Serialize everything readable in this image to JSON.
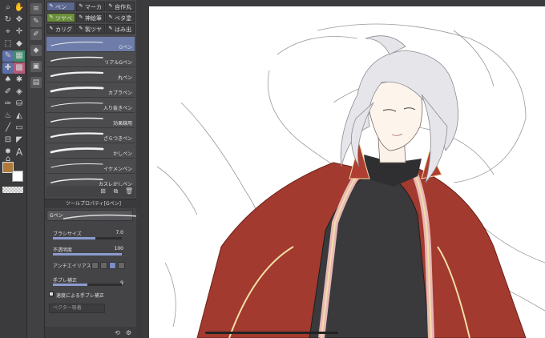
{
  "subtool_tabs": [
    {
      "label": "ペン",
      "active": true
    },
    {
      "label": "マーカ",
      "active": false
    },
    {
      "label": "自作丸",
      "active": false
    },
    {
      "label": "ツヤベ",
      "active": true
    },
    {
      "label": "神絵筆",
      "active": false
    },
    {
      "label": "ベタ塗",
      "active": false
    },
    {
      "label": "カリグ",
      "active": false
    },
    {
      "label": "製ツヤ",
      "active": false
    },
    {
      "label": "はみ出",
      "active": false
    }
  ],
  "brushes": [
    {
      "name": "Gペン",
      "selected": true
    },
    {
      "name": "リアルGペン",
      "selected": false
    },
    {
      "name": "丸ペン",
      "selected": false
    },
    {
      "name": "カブラペン",
      "selected": false
    },
    {
      "name": "入り抜きペン",
      "selected": false
    },
    {
      "name": "効果線用",
      "selected": false
    },
    {
      "name": "ざらつきペン",
      "selected": false
    },
    {
      "name": "かしペン",
      "selected": false
    },
    {
      "name": "イケメンペン",
      "selected": false
    },
    {
      "name": "カスレかしペン",
      "selected": false
    }
  ],
  "tool_property": {
    "header": "ツールプロパティ[Gペン]",
    "preview_label": "Gペン",
    "brush_size_label": "ブラシサイズ",
    "brush_size_value": "7.0",
    "brush_size_fraction": 0.62,
    "opacity_label": "不透明度",
    "opacity_value": "100",
    "opacity_fraction": 1.0,
    "antialias_label": "アンチエイリアス",
    "stabilization_label": "手ブレ補正",
    "stabilization_value": "9",
    "stabilization_fraction": 0.5,
    "speed_stab_label": "速度による手ブレ補正",
    "speed_stab_checked": true,
    "vector_snap_label": "ベクター吸着"
  },
  "colors": {
    "main_color": "#b07a3a",
    "sub_color": "#ffffff",
    "accent": "#5c6790"
  },
  "canvas": {
    "subject": "anime-style illustration: silver-haired man in red and black jacket lying on a pillow"
  }
}
